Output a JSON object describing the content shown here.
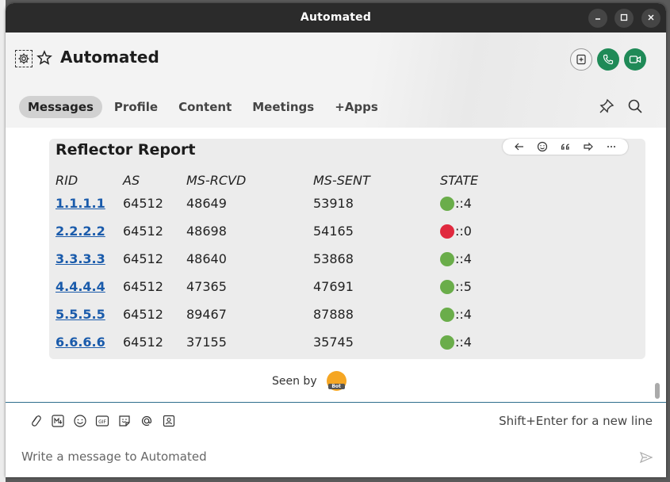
{
  "window": {
    "title": "Automated",
    "controls": [
      "minimize",
      "maximize",
      "close"
    ]
  },
  "header": {
    "chat_title": "Automated",
    "icons": [
      "gear-icon",
      "star-icon",
      "add-app-icon",
      "phone-icon",
      "video-icon"
    ],
    "accent": "#1f8a57"
  },
  "tabs": [
    {
      "label": "Messages",
      "active": true
    },
    {
      "label": "Profile",
      "active": false
    },
    {
      "label": "Content",
      "active": false
    },
    {
      "label": "Meetings",
      "active": false
    },
    {
      "label": "+Apps",
      "active": false
    }
  ],
  "report": {
    "title": "Reflector Report",
    "columns": [
      "RID",
      "AS",
      "MS-RCVD",
      "MS-SENT",
      "STATE"
    ],
    "rows": [
      {
        "rid": "1.1.1.1",
        "as": "64512",
        "rcvd": "48649",
        "sent": "53918",
        "state_color": "#6aad4a",
        "state": "::4"
      },
      {
        "rid": "2.2.2.2",
        "as": "64512",
        "rcvd": "48698",
        "sent": "54165",
        "state_color": "#e0293e",
        "state": "::0"
      },
      {
        "rid": "3.3.3.3",
        "as": "64512",
        "rcvd": "48640",
        "sent": "53868",
        "state_color": "#6aad4a",
        "state": "::4"
      },
      {
        "rid": "4.4.4.4",
        "as": "64512",
        "rcvd": "47365",
        "sent": "47691",
        "state_color": "#6aad4a",
        "state": "::5"
      },
      {
        "rid": "5.5.5.5",
        "as": "64512",
        "rcvd": "89467",
        "sent": "87888",
        "state_color": "#6aad4a",
        "state": "::4"
      },
      {
        "rid": "6.6.6.6",
        "as": "64512",
        "rcvd": "37155",
        "sent": "35745",
        "state_color": "#6aad4a",
        "state": "::4"
      }
    ]
  },
  "seen": {
    "label": "Seen by",
    "avatar_label": "Bot"
  },
  "composer": {
    "hint": "Shift+Enter for a new line",
    "placeholder": "Write a message to Automated"
  }
}
